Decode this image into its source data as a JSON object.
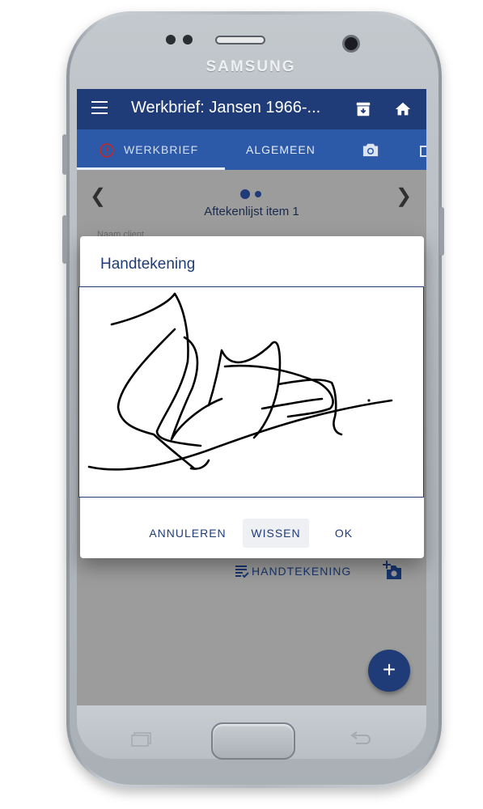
{
  "device": {
    "brand": "SAMSUNG"
  },
  "appbar": {
    "title": "Werkbrief: Jansen 1966-...",
    "menu_icon": "menu-icon",
    "archive_icon": "archive-icon",
    "home_icon": "home-icon"
  },
  "tabs": [
    {
      "label": "WERKBRIEF",
      "active": true,
      "icon": "alert-circle-icon"
    },
    {
      "label": "ALGEMEEN",
      "active": false
    },
    {
      "label": "",
      "icon": "camera-icon"
    }
  ],
  "pager": {
    "title": "Aftekenlijst item 1",
    "page": 1,
    "pages": 2,
    "hidden_label": "Naam client"
  },
  "signature_row": {
    "label": "HANDTEKENING",
    "icon": "signature-list-icon",
    "photo_icon": "add-photo-icon"
  },
  "fab": {
    "label": "+"
  },
  "dialog": {
    "title": "Handtekening",
    "actions": {
      "cancel": "ANNULEREN",
      "clear": "WISSEN",
      "ok": "OK"
    }
  },
  "colors": {
    "primary": "#1f3c78",
    "tab_bar": "#2c5aa8",
    "accent_alert": "#c62828",
    "scrim": "#9c9c9c"
  }
}
